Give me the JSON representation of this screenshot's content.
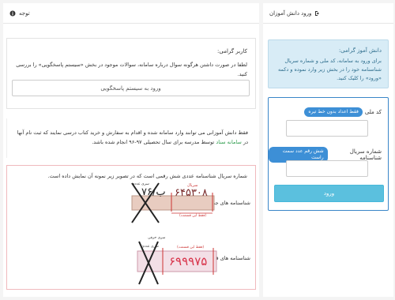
{
  "header": {
    "login_title": "ورود دانش آموزان",
    "notice_title": "توجه"
  },
  "login": {
    "info_title": "دانش آموز گرامی:",
    "info_text": "برای ورود به سامانه، کد ملی و شماره سریال شناسنامه خود را در بخش زیر وارد نموده و دکمه «ورود» را کلیک کنید.",
    "national_code_label": "کد ملی",
    "national_code_badge": "فقط اعداد بدون خط تیره",
    "serial_label": "شماره سریال شناسنامه",
    "serial_badge": "شش رقم عدد سمت راست",
    "submit_label": "ورود"
  },
  "notice": {
    "greeting": "کاربر گرامی:",
    "faq_text": "لطفا در صورت داشتن هرگونه سوال درباره سامانه، سوالات موجود در بخش «سیستم پاسخگویی» را بررسی کنید.",
    "faq_button": "ورود به سیستم پاسخگویی",
    "reg_text_1": "فقط دانش آموزانی می توانند وارد سامانه شده و اقدام به سفارش و خرید کتاب درسی نمایند که ثبت نام آنها در",
    "reg_link": "سامانه سناد",
    "reg_text_2": "توسط مدرسه برای سال تحصیلی ۹۷-۹۶ انجام شده باشد.",
    "serial_intro": "شماره سریال شناسنامه عددی شش رقمی است که در تصویر زیر نمونه آن نمایش داده است.",
    "new_id_caption": "شناسنامه های جدید",
    "old_id_caption": "شناسنامه های قدیمی",
    "new_id_number": "۶۴۵۳۰۸",
    "new_id_prefix": "ب/۷۶",
    "old_id_number": "۶۹۹۹۷۵",
    "ann_serial": "سریال",
    "ann_sub_serial": "سری عددی",
    "ann_letter_serial": "سری حرفی",
    "ann_only_this": "(فقط این قسمت)"
  },
  "colors": {
    "accent": "#3a86c8",
    "info_bg": "#d8ecf6",
    "button": "#5bc0de",
    "link_green": "#2e9c4d",
    "alert_border": "#f0b9bd"
  }
}
